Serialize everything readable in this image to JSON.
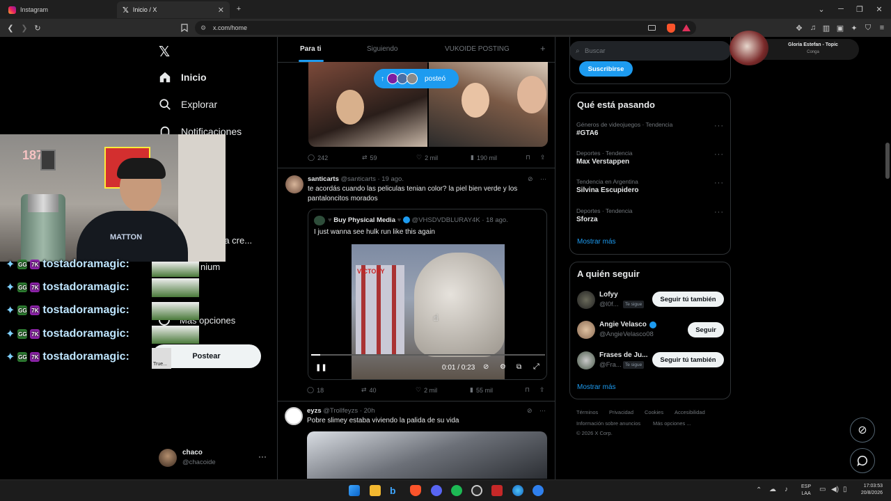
{
  "browser": {
    "tabs": [
      {
        "title": "Instagram"
      },
      {
        "title": "Inicio / X"
      }
    ],
    "url": "x.com/home"
  },
  "nav": {
    "home": "Inicio",
    "explore": "Explorar",
    "notifications": "Notificaciones",
    "communities_partial": "ra cre...",
    "premium_partial": "nium",
    "more": "Más opciones",
    "post_button": "Postear",
    "account_name": "chaco",
    "account_handle": "@chacoide"
  },
  "overlay": {
    "chat_user": "tostadoramagic:",
    "chat_thumb_label": "True...",
    "wall_sign_number": "187"
  },
  "feed_tabs": [
    "Para ti",
    "Siguiendo",
    "VUKOIDE POSTING"
  ],
  "new_posts_pill": "posteó",
  "tweets": [
    {
      "stats": {
        "replies": "242",
        "reposts": "59",
        "likes": "2 mil",
        "views": "190 mil"
      }
    },
    {
      "name": "santicarts",
      "handle": "@santicarts · 19 ago.",
      "text": "te acordás cuando las peliculas tenian color? la piel bien verde y los pantaloncitos morados",
      "quote": {
        "name": "Buy Physical Media",
        "handle": "@VHSDVDBLURAY4K · 18 ago.",
        "text": "I just wanna see hulk run like this again",
        "sign_text": "VICTORY",
        "time": "0:01 / 0:23",
        "progress": 0.04
      },
      "stats": {
        "replies": "18",
        "reposts": "40",
        "likes": "2 mil",
        "views": "55 mil"
      }
    },
    {
      "name": "eyzs",
      "handle": "@Trollfeyzs · 20h",
      "text": "Pobre slimey estaba viviendo la palida de su vida"
    }
  ],
  "right": {
    "search_placeholder": "Buscar",
    "subscribe_button": "Suscribirse",
    "trends_title": "Qué está pasando",
    "trends": [
      {
        "category": "Géneros de videojuegos · Tendencia",
        "name": "#GTA6"
      },
      {
        "category": "Deportes · Tendencia",
        "name": "Max Verstappen"
      },
      {
        "category": "Tendencia en Argentina",
        "name": "Silvina Escupidero"
      },
      {
        "category": "Deportes · Tendencia",
        "name": "Sforza"
      }
    ],
    "show_more": "Mostrar más",
    "follow_title": "A quién seguir",
    "suggestions": [
      {
        "name": "Lofyy",
        "handle": "@l0f...",
        "badge": "Te sigue",
        "button": "Seguir tú también"
      },
      {
        "name": "Angie Velasco",
        "handle": "@AngieVelasco08",
        "badge": "",
        "button": "Seguir"
      },
      {
        "name": "Frases de Ju...",
        "handle": "@Fra...",
        "badge": "Te sigue",
        "button": "Seguir tú también"
      }
    ],
    "footer": [
      "Términos",
      "Privacidad",
      "Cookies",
      "Accesibilidad",
      "Información sobre anuncios",
      "Más opciones ...",
      "© 2026 X Corp."
    ]
  },
  "now_playing": {
    "title": "Gloria Estefan - Topic",
    "subtitle": "Conga"
  },
  "taskbar": {
    "lang": "ESP",
    "lang2": "LAA",
    "time": "17:03:53",
    "date": "20/8/2026"
  }
}
